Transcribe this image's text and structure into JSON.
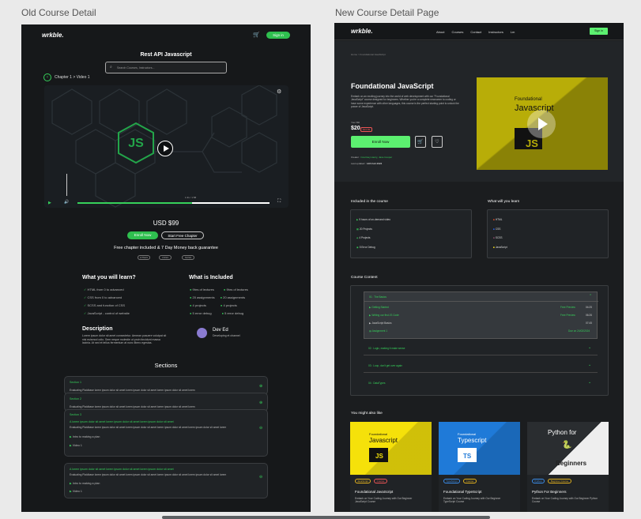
{
  "captions": {
    "old": "Old Course Detail",
    "new": "New Course Detail Page"
  },
  "old": {
    "logo": "wrkble.",
    "signin": "Sign in",
    "title": "Rest API Javascript",
    "search_placeholder": "Search Courses, Instructors...",
    "breadcrumb": "Chapter 1 > Video 1",
    "video_time": "1:31 / 1:58",
    "price": "USD $99",
    "enroll": "Enroll Now",
    "start_free": "Start Free Chapter",
    "free_note": "Free chapter included & 7 Day Money back guarantee",
    "badges": [
      "HTML5",
      "CSS3",
      "SCSS"
    ],
    "learn_title": "What you will learn?",
    "learn_items": [
      "HTML from 0 to advanced",
      "CSS from 0 to advanced",
      "SCSS and function of CSS",
      "JavaScript - control of website"
    ],
    "included_title": "What is Included",
    "included_items": [
      "9hrs of lectures",
      "9hrs of lectures",
      "20 assignments",
      "20 assignments",
      "4 projects",
      "4 projects",
      "5 error debug",
      "5 error debug"
    ],
    "desc_title": "Description",
    "desc_text": "Lorem ipsum dolor sit amet consectetur. Aenean posuere volutpat sit nisi euismod odio. Sem neque molestie ut proin tincidunt massa lacinia. At sed et tellus fermentum at nunc libero egestas.",
    "instructor_name": "Dev Ed",
    "instructor_role": "Developing et channel",
    "sections_title": "Sections",
    "sections": [
      {
        "title": "Section 1",
        "text": "Evaluating Plaidbase lorem ipsum dolor sit amet lorem ipsum dolor sit amet lorem ipsum dolor sit amet lorem"
      },
      {
        "title": "Section 2",
        "text": "Evaluating Plaidbase lorem ipsum dolor sit amet lorem ipsum dolor sit amet lorem ipsum dolor sit amet lorem"
      },
      {
        "title": "Section 3",
        "text": "Evaluating Plaidbase lorem ipsum dolor sit amet lorem ipsum dolor sit amet lorem ipsum dolor sit amet lorem"
      }
    ],
    "section_open_title": "A lorem ipsum dolor sit amet lorem ipsum dolor sit amet lorem ipsum dolor sit amet",
    "section_open_text": "Evaluating Plaidbase lorem ipsum dolor sit amet lorem ipsum dolor sit amet lorem ipsum dolor sit amet lorem ipsum dolor sit amet lorem",
    "section_open_items": [
      "Intro to making a plan",
      "Video 1"
    ],
    "section4_title": "A lorem ipsum dolor sit amet lorem ipsum dolor sit amet lorem ipsum dolor sit amet",
    "section4_text": "Evaluating Plaidbase lorem ipsum dolor sit amet lorem ipsum dolor sit amet lorem ipsum dolor sit amet lorem ipsum dolor sit amet lorem",
    "section4_items": [
      "Intro to making a plan",
      "Video 1"
    ]
  },
  "new": {
    "logo": "wrkble.",
    "nav": [
      "About",
      "Courses",
      "Contact",
      "Instructors",
      "Lm"
    ],
    "signin": "Sign in",
    "breadcrumb": "Home > Foundational JavaScript",
    "title": "Foundational JavaScript",
    "intro": "Embark on an exciting journey into the world of web development with our \"Foundational JavaScript\" course designed for beginners. Whether you're a complete newcomer to coding or have some experience with other languages, this course is the perfect starting point to unlock the power of JavaScript.",
    "price_label": "Your Bill",
    "price": "$20",
    "old_price": "$34.99",
    "enroll": "Enroll Now",
    "creator_label": "Creator :",
    "creator": "Courtney Henry, Jane Cooper",
    "updated_label": "Last updated :",
    "updated": "14th Feb 2024",
    "thumb_top": "Foundational",
    "thumb_main": "Javascript",
    "thumb_js": "JS",
    "included_title": "Included in the course",
    "included_items": [
      "9 hours of on-demand video",
      "20 Projects",
      "4 Projects",
      "5 Error Debug"
    ],
    "learn_title": "What will you learn",
    "learn_items": [
      "HTML",
      "CSS",
      "SCSS",
      "JavaScript"
    ],
    "content_title": "Course Content",
    "module1": "01 : The Basics",
    "lessons": [
      {
        "name": "Getting Started",
        "status": "Free Preview",
        "time": "04:25"
      },
      {
        "name": "Writing our first JS Code",
        "status": "Free Preview",
        "time": "06:26"
      },
      {
        "name": "JavaScript Basics",
        "status": "",
        "time": "07:45"
      },
      {
        "name": "Assignment 1",
        "status": "Due on 24/02/2024",
        "time": ""
      }
    ],
    "modules": [
      "02 : Logic, making it make sense",
      "03 : Loop, don't get over again",
      "04 : DataTypes"
    ],
    "also_title": "You might also like",
    "cards": [
      {
        "top": "Foundational",
        "main": "Javascript",
        "badge": "JS",
        "tags": [
          "JavaScript",
          "Course"
        ],
        "name": "Foundational JavaScript",
        "desc": "Embark on Your Coding Journey with Our Beginner JavaScript Course",
        "bg": "#f5e10a",
        "txt": "#111"
      },
      {
        "top": "Foundational",
        "main": "Typescript",
        "badge": "TS",
        "tags": [
          "TypeScript",
          "Course"
        ],
        "name": "Foundational TypeScript",
        "desc": "Embark on Your Coding Journey with Our Beginner TypeScript Course",
        "bg": "#1f7ad8",
        "txt": "#fff"
      },
      {
        "top": "Python for",
        "main": "Beginners",
        "badge": "",
        "tags": [
          "Python",
          "Beginner Course"
        ],
        "name": "Python For Beginners",
        "desc": "Embark on Your Coding Journey with Our Beginner Python Course",
        "bg": "#eeeeee",
        "txt": "#111"
      }
    ]
  },
  "colors": {
    "accent": "#36d15a",
    "thumb": "#b8ad08"
  }
}
